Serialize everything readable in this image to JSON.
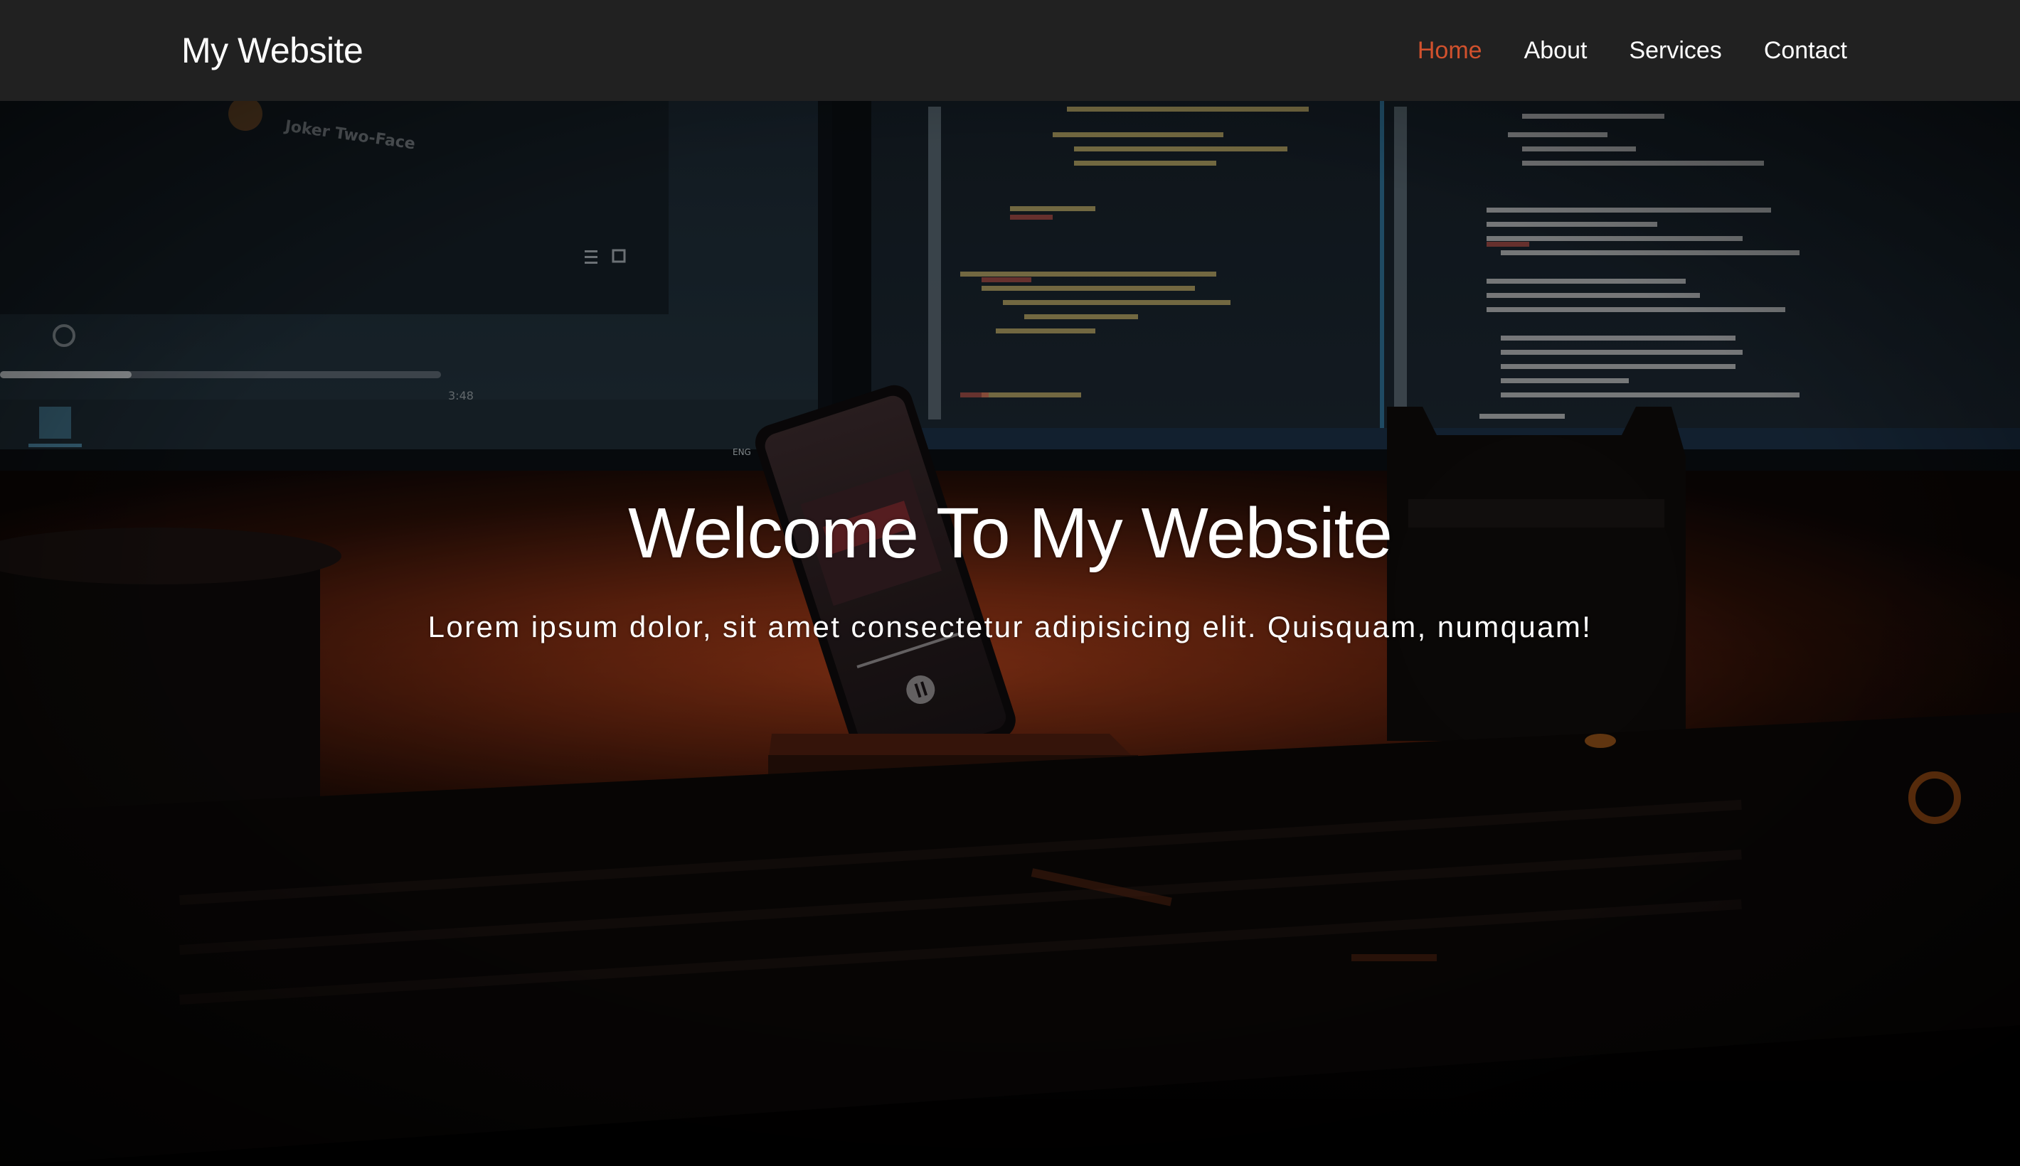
{
  "navbar": {
    "brand": "My Website",
    "links": [
      {
        "label": "Home",
        "active": true
      },
      {
        "label": "About",
        "active": false
      },
      {
        "label": "Services",
        "active": false
      },
      {
        "label": "Contact",
        "active": false
      }
    ]
  },
  "hero": {
    "title": "Welcome To My Website",
    "subtitle": "Lorem ipsum dolor, sit amet consectetur adipisicing elit. Quisquam, numquam!"
  },
  "colors": {
    "navbar_bg": "#212121",
    "active_link": "#d1512d",
    "text": "#ffffff",
    "desk_glow": "#c2461a"
  }
}
